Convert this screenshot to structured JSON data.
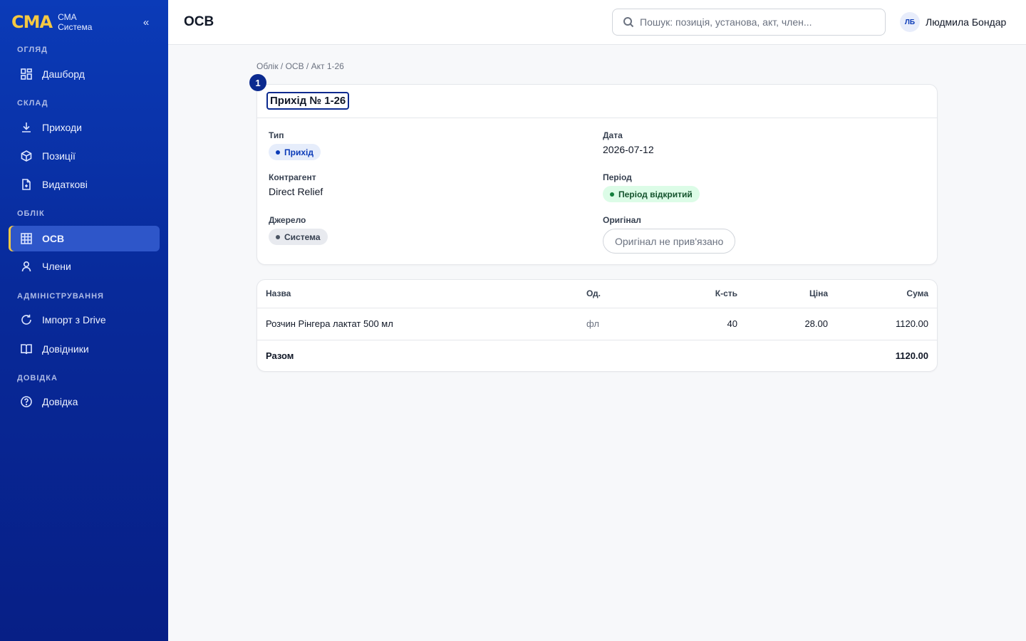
{
  "brand": {
    "logo": "CMA",
    "line1": "СМА",
    "line2": "Система",
    "collapse": "«"
  },
  "sidebar": {
    "sections": [
      {
        "label": "ОГЛЯД"
      },
      {
        "label": "СКЛАД"
      },
      {
        "label": "ОБЛІК"
      },
      {
        "label": "АДМІНІСТРУВАННЯ"
      },
      {
        "label": "ДОВІДКА"
      }
    ],
    "items": [
      {
        "label": "Дашборд",
        "icon": "dashboard-icon"
      },
      {
        "label": "Приходи",
        "icon": "download-icon"
      },
      {
        "label": "Позиції",
        "icon": "box-icon"
      },
      {
        "label": "Видаткові",
        "icon": "file-icon"
      },
      {
        "label": "ОСВ",
        "icon": "table-icon",
        "active": true
      },
      {
        "label": "Члени",
        "icon": "user-icon"
      },
      {
        "label": "Імпорт з Drive",
        "icon": "refresh-icon"
      },
      {
        "label": "Довідники",
        "icon": "book-icon"
      },
      {
        "label": "Довідка",
        "icon": "help-icon"
      }
    ]
  },
  "header": {
    "title": "ОСВ",
    "search_placeholder": "Пошук: позиція, установа, акт, член...",
    "user_initials": "ЛБ",
    "user_name": "Людмила Бондар"
  },
  "breadcrumb": "Облік / ОСВ / Акт 1-26",
  "step_number": "1",
  "document": {
    "title": "Прихід № 1-26",
    "type_label": "Тип",
    "type_value": "Прихід",
    "date_label": "Дата",
    "date_value": "2026-07-12",
    "counterparty_label": "Контрагент",
    "counterparty_value": "Direct Relief",
    "period_label": "Період",
    "period_value": "Період відкритий",
    "source_label": "Джерело",
    "source_value": "Система",
    "original_label": "Оригінал",
    "original_value": "Оригінал не прив'язано"
  },
  "table": {
    "headers": {
      "name": "Назва",
      "unit": "Од.",
      "qty": "К-сть",
      "price": "Ціна",
      "sum": "Сума"
    },
    "rows": [
      {
        "name": "Розчин Рінгера лактат 500 мл",
        "unit": "фл",
        "qty": "40",
        "price": "28.00",
        "sum": "1120.00"
      }
    ],
    "total_label": "Разом",
    "total_value": "1120.00"
  },
  "colors": {
    "sidebar": "#0b3bb8",
    "accent": "#f5c842",
    "primary": "#0b2a8f"
  }
}
